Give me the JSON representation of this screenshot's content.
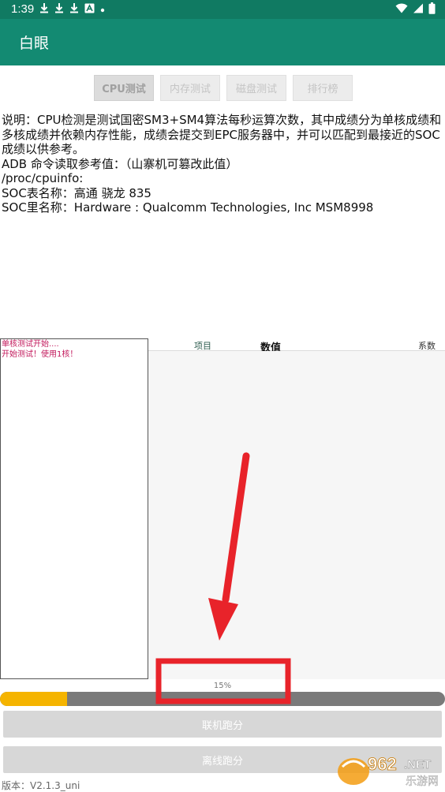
{
  "status_bar": {
    "time": "1:39",
    "notifications": [
      "download-icon",
      "download-icon",
      "download-icon",
      "a-icon",
      "dot-icon"
    ],
    "system_icons": [
      "wifi-icon",
      "signal-icon",
      "battery-icon"
    ]
  },
  "app": {
    "title": "白眼"
  },
  "tabs": [
    {
      "label": "CPU测试",
      "active": true
    },
    {
      "label": "内存测试",
      "active": false
    },
    {
      "label": "磁盘测试",
      "active": false
    },
    {
      "label": "排行榜",
      "active": false
    }
  ],
  "info": {
    "description": "说明：CPU检测是测试国密SM3+SM4算法每秒运算次数，其中成绩分为单核成绩和多核成绩并依赖内存性能，成绩会提交到EPC服务器中，并可以匹配到最接近的SOC成绩以供参考。",
    "adb_line": "ADB 命令读取参考值：（山寨机可篡改此值）",
    "cpuinfo_path": "/proc/cpuinfo:",
    "soc_table_name": "SOC表名称：高通 骁龙 835",
    "soc_inner_name": "SOC里名称：Hardware : Qualcomm Technologies, Inc MSM8998"
  },
  "log": {
    "lines": [
      "单核测试开始....",
      "开始测试！使用1核！"
    ]
  },
  "results": {
    "col_item": "项目",
    "col_value": "数值",
    "col_coef": "系数"
  },
  "progress": {
    "label": "15%",
    "value": 0.15
  },
  "buttons": {
    "online": "联机跑分",
    "offline": "离线跑分"
  },
  "version": "版本：V2.1.3_uni",
  "watermark": {
    "brand": "962",
    "tld": ".NET",
    "cn": "乐游网"
  },
  "colors": {
    "status_bar": "#107a62",
    "app_bar": "#138a72",
    "progress_fill": "#f5b400",
    "progress_track": "#7a7a7a",
    "log_text": "#c2185b",
    "annotation_red": "#e8232a"
  }
}
